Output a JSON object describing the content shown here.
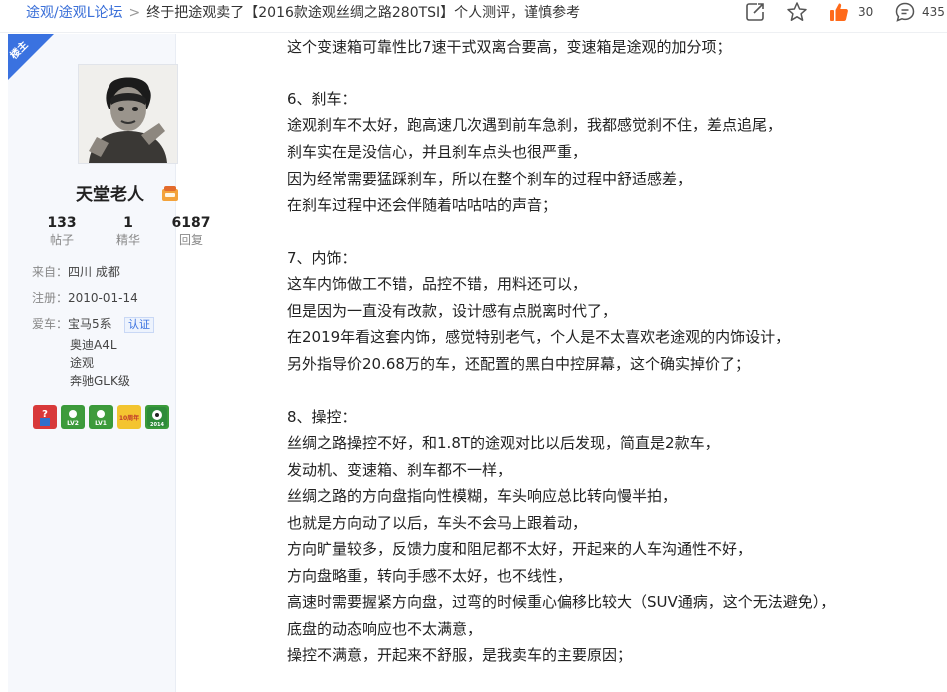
{
  "breadcrumb": {
    "forum": "途观/途观L论坛",
    "separator": ">",
    "title": "终于把途观卖了【2016款途观丝绸之路280TSI】个人测评，谨慎参考"
  },
  "actions": {
    "like_count": "30",
    "comment_count": "435",
    "icons": [
      "share-icon",
      "star-icon",
      "thumbs-up-icon",
      "comment-icon"
    ],
    "like_color": "#ff6a1a"
  },
  "user": {
    "badge": "楼主",
    "name": "天堂老人",
    "stats": [
      {
        "value": "133",
        "label": "帖子"
      },
      {
        "value": "1",
        "label": "精华"
      },
      {
        "value": "6187",
        "label": "回复"
      }
    ],
    "from_label": "来自：",
    "from_value": "四川 成都",
    "reg_label": "注册：",
    "reg_value": "2010-01-14",
    "cars_label": "爱车：",
    "cars": [
      "宝马5系",
      "奥迪A4L",
      "途观",
      "奔驰GLK级"
    ],
    "auth": "认证",
    "medals": [
      "LV2",
      "LV1",
      "10周年",
      "2014"
    ]
  },
  "post_lines": [
    "这个变速箱可靠性比7速干式双离合要高，变速箱是途观的加分项；",
    "",
    "6、刹车：",
    "途观刹车不太好，跑高速几次遇到前车急刹，我都感觉刹不住，差点追尾，",
    "刹车实在是没信心，并且刹车点头也很严重，",
    "因为经常需要猛踩刹车，所以在整个刹车的过程中舒适感差，",
    "在刹车过程中还会伴随着咕咕咕的声音；",
    "",
    "7、内饰：",
    "这车内饰做工不错，品控不错，用料还可以，",
    "但是因为一直没有改款，设计感有点脱离时代了，",
    "在2019年看这套内饰，感觉特别老气，个人是不太喜欢老途观的内饰设计，",
    "另外指导价20.68万的车，还配置的黑白中控屏幕，这个确实掉价了；",
    "",
    "8、操控：",
    "丝绸之路操控不好，和1.8T的途观对比以后发现，简直是2款车，",
    "发动机、变速箱、刹车都不一样，",
    "丝绸之路的方向盘指向性模糊，车头响应总比转向慢半拍，",
    "也就是方向动了以后，车头不会马上跟着动，",
    "方向旷量较多，反馈力度和阻尼都不太好，开起来的人车沟通性不好，",
    "方向盘略重，转向手感不太好，也不线性，",
    "高速时需要握紧方向盘，过弯的时候重心偏移比较大（SUV通病，这个无法避免），",
    "底盘的动态响应也不太满意，",
    "操控不满意，开起来不舒服，是我卖车的主要原因；"
  ]
}
